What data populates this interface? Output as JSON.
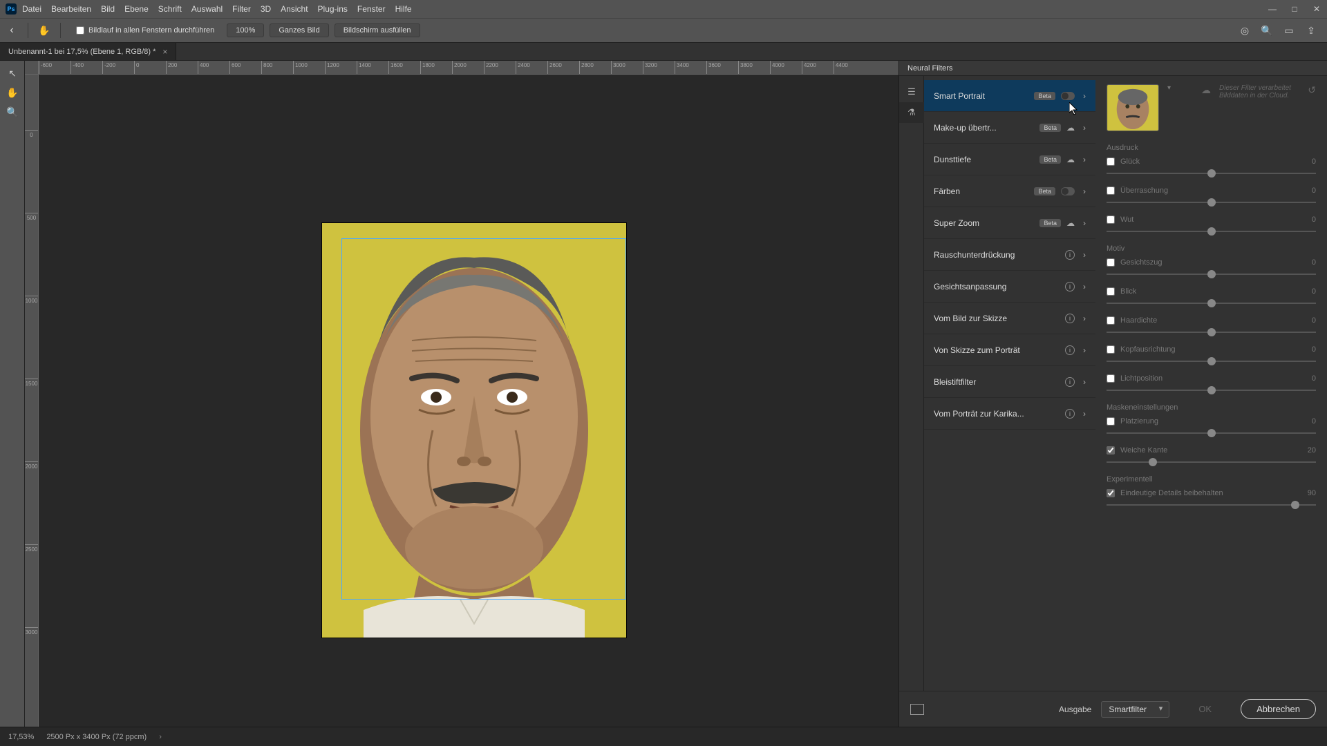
{
  "menu": [
    "Datei",
    "Bearbeiten",
    "Bild",
    "Ebene",
    "Schrift",
    "Auswahl",
    "Filter",
    "3D",
    "Ansicht",
    "Plug-ins",
    "Fenster",
    "Hilfe"
  ],
  "optbar": {
    "scroll_check": "Bildlauf in allen Fenstern durchführen",
    "zoom": "100%",
    "fit": "Ganzes Bild",
    "fill": "Bildschirm ausfüllen"
  },
  "tab": {
    "title": "Unbenannt-1 bei 17,5% (Ebene 1, RGB/8) *"
  },
  "ruler_ticks": [
    "-600",
    "-400",
    "-200",
    "0",
    "200",
    "400",
    "600",
    "800",
    "1000",
    "1200",
    "1400",
    "1600",
    "1800",
    "2000",
    "2200",
    "2400",
    "2600",
    "2800",
    "3000",
    "3200",
    "3400",
    "3600",
    "3800",
    "4000",
    "4200",
    "4400"
  ],
  "panel": {
    "title": "Neural Filters",
    "filters": [
      {
        "label": "Smart Portrait",
        "beta": true,
        "icon": "toggle",
        "active": true
      },
      {
        "label": "Make-up übertr...",
        "beta": true,
        "icon": "cloud"
      },
      {
        "label": "Dunsttiefe",
        "beta": true,
        "icon": "cloud"
      },
      {
        "label": "Färben",
        "beta": true,
        "icon": "toggle"
      },
      {
        "label": "Super Zoom",
        "beta": true,
        "icon": "cloud"
      },
      {
        "label": "Rauschunterdrückung",
        "beta": false,
        "icon": "info"
      },
      {
        "label": "Gesichtsanpassung",
        "beta": false,
        "icon": "info"
      },
      {
        "label": "Vom Bild zur Skizze",
        "beta": false,
        "icon": "info"
      },
      {
        "label": "Von Skizze zum Porträt",
        "beta": false,
        "icon": "info"
      },
      {
        "label": "Bleistiftfilter",
        "beta": false,
        "icon": "info"
      },
      {
        "label": "Vom Porträt zur Karika...",
        "beta": false,
        "icon": "info"
      }
    ],
    "cloudnote": "Dieser Filter verarbeitet Bilddaten in der Cloud.",
    "sections": {
      "ausdruck": "Ausdruck",
      "motiv": "Motiv",
      "masken": "Maskeneinstellungen",
      "exp": "Experimentell"
    },
    "sliders_ausdruck": [
      {
        "label": "Glück",
        "val": "0"
      },
      {
        "label": "Überraschung",
        "val": "0"
      },
      {
        "label": "Wut",
        "val": "0"
      }
    ],
    "sliders_motiv": [
      {
        "label": "Gesichtszug",
        "val": "0"
      },
      {
        "label": "Blick",
        "val": "0"
      },
      {
        "label": "Haardichte",
        "val": "0"
      },
      {
        "label": "Kopfausrichtung",
        "val": "0"
      },
      {
        "label": "Lichtposition",
        "val": "0"
      }
    ],
    "sliders_masken": [
      {
        "label": "Platzierung",
        "val": "0",
        "checked": false
      },
      {
        "label": "Weiche Kante",
        "val": "20",
        "checked": true,
        "knob": 22
      }
    ],
    "sliders_exp": [
      {
        "label": "Eindeutige Details beibehalten",
        "val": "90",
        "checked": true,
        "knob": 90
      }
    ],
    "output_label": "Ausgabe",
    "output_value": "Smartfilter",
    "ok": "OK",
    "cancel": "Abbrechen"
  },
  "status": {
    "zoom": "17,53%",
    "doc": "2500 Px x 3400 Px (72 ppcm)"
  }
}
